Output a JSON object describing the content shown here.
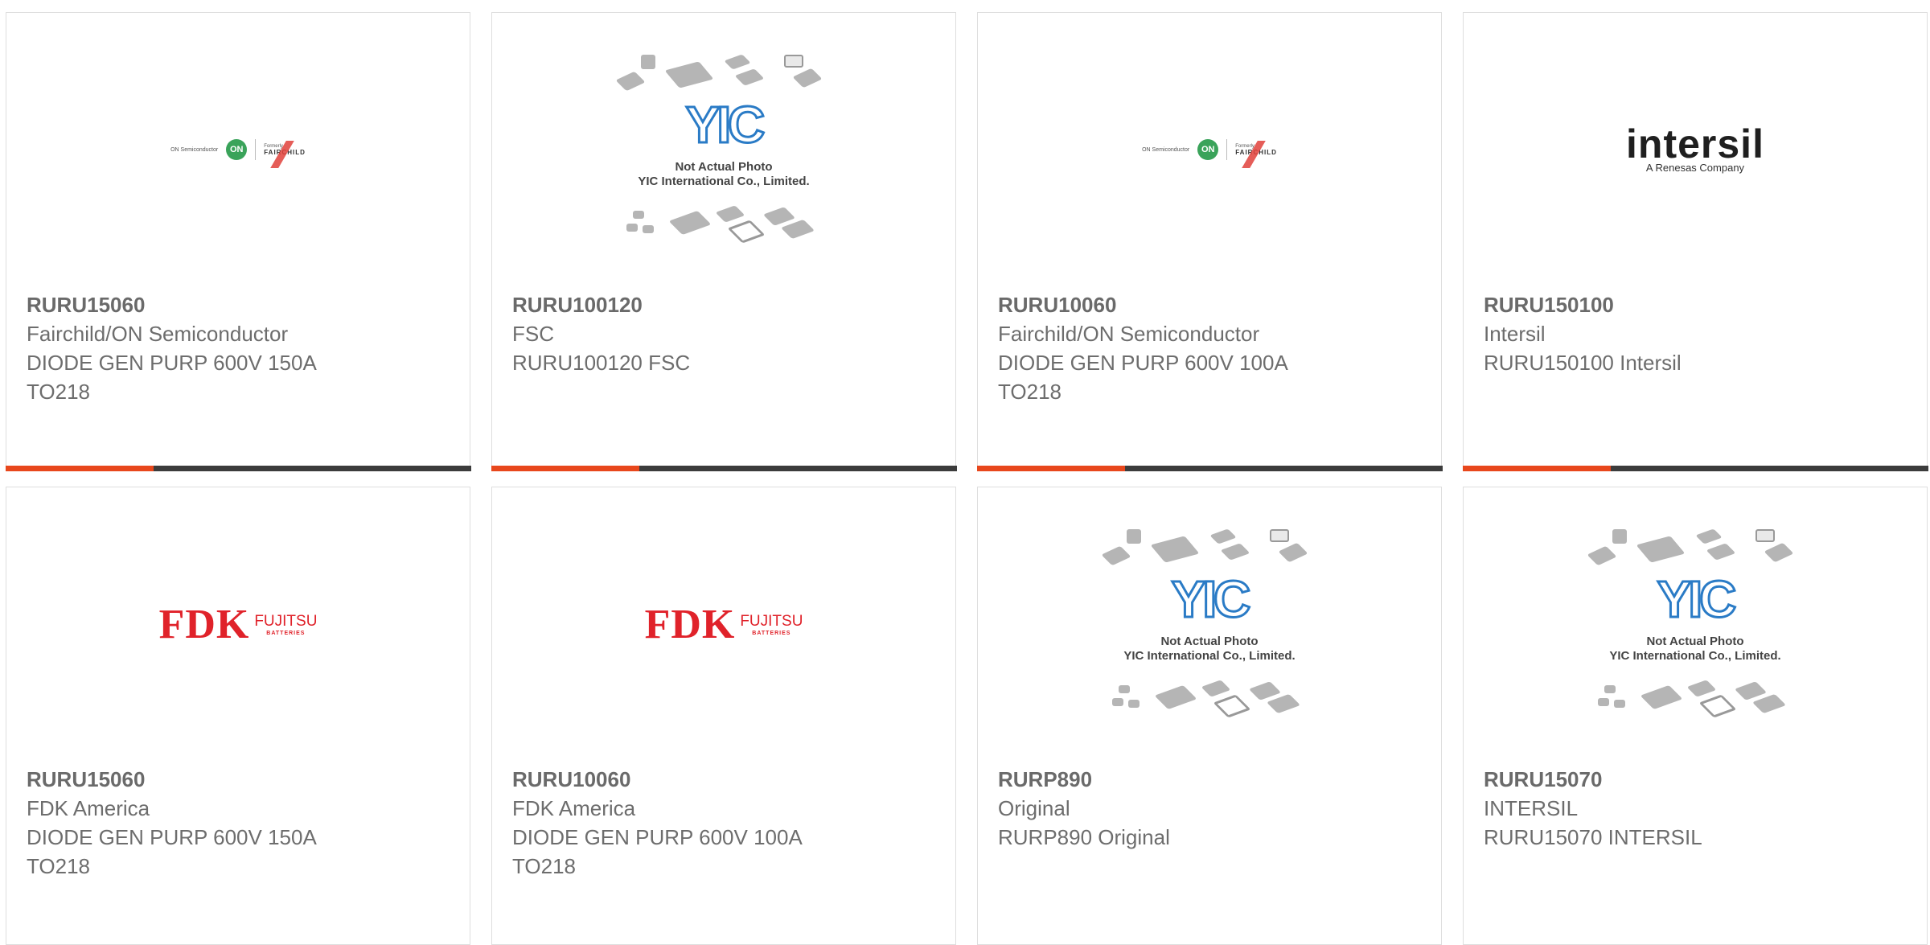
{
  "cards": [
    {
      "pn": "RURU15060",
      "mfr": "Fairchild/ON Semiconductor",
      "desc1": "DIODE GEN PURP 600V 150A",
      "desc2": "TO218",
      "logo": "on-fairchild-logo"
    },
    {
      "pn": "RURU100120",
      "mfr": "FSC",
      "desc1": "RURU100120 FSC",
      "desc2": "",
      "logo": "yic-not-actual-photo"
    },
    {
      "pn": "RURU10060",
      "mfr": "Fairchild/ON Semiconductor",
      "desc1": "DIODE GEN PURP 600V 100A",
      "desc2": "TO218",
      "logo": "on-fairchild-logo"
    },
    {
      "pn": "RURU150100",
      "mfr": "Intersil",
      "desc1": "RURU150100 Intersil",
      "desc2": "",
      "logo": "intersil-logo"
    },
    {
      "pn": "RURU15060",
      "mfr": "FDK America",
      "desc1": "DIODE GEN PURP 600V 150A",
      "desc2": "TO218",
      "logo": "fdk-fujitsu-logo"
    },
    {
      "pn": "RURU10060",
      "mfr": "FDK America",
      "desc1": "DIODE GEN PURP 600V 100A",
      "desc2": "TO218",
      "logo": "fdk-fujitsu-logo"
    },
    {
      "pn": "RURP890",
      "mfr": "Original",
      "desc1": "RURP890 Original",
      "desc2": "",
      "logo": "yic-not-actual-photo"
    },
    {
      "pn": "RURU15070",
      "mfr": "INTERSIL",
      "desc1": "RURU15070 INTERSIL",
      "desc2": "",
      "logo": "yic-not-actual-photo"
    }
  ],
  "logos": {
    "on_semi_text": "ON Semiconductor",
    "on_mark": "ON",
    "formerly": "Formerly",
    "fairchild": "FAIRCHILD",
    "intersil_name": "intersil",
    "intersil_sub": "A Renesas Company",
    "fdk": "FDK",
    "fujitsu": "FUJITSU",
    "batteries": "BATTERIES",
    "yic_mark": "YIC",
    "yic_line1": "Not Actual Photo",
    "yic_line2": "YIC International Co., Limited."
  },
  "colors": {
    "accent": "#e8471c",
    "bar": "#3c3c3c",
    "border": "#dedede",
    "text": "#6d6d6d"
  }
}
